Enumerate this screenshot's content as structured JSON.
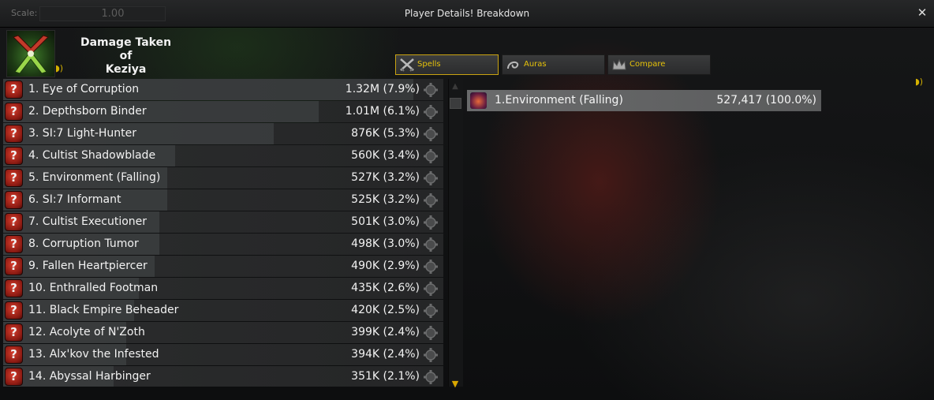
{
  "window": {
    "title": "Player Details! Breakdown",
    "scale_label": "Scale:",
    "scale_value": "1.00",
    "close_symbol": "✕"
  },
  "header": {
    "title_line1": "Damage Taken of",
    "title_line2": "Keziya"
  },
  "tabs": [
    {
      "label": "Spells",
      "icon": "crossed-swords-icon",
      "active": true
    },
    {
      "label": "Auras",
      "icon": "aura-swirl-icon",
      "active": false
    },
    {
      "label": "Compare",
      "icon": "crown-icon",
      "active": false
    }
  ],
  "list": {
    "rows": [
      {
        "name": "1. Eye of Corruption",
        "value": "1.32M (7.9%)",
        "bar_fraction": 1.0
      },
      {
        "name": "2. Depthsborn Binder",
        "value": "1.01M (6.1%)",
        "bar_fraction": 0.77
      },
      {
        "name": "3. SI:7 Light-Hunter",
        "value": "876K (5.3%)",
        "bar_fraction": 0.66
      },
      {
        "name": "4. Cultist Shadowblade",
        "value": "560K (3.4%)",
        "bar_fraction": 0.42
      },
      {
        "name": "5. Environment (Falling)",
        "value": "527K (3.2%)",
        "bar_fraction": 0.4
      },
      {
        "name": "6. SI:7 Informant",
        "value": "525K (3.2%)",
        "bar_fraction": 0.4
      },
      {
        "name": "7. Cultist Executioner",
        "value": "501K (3.0%)",
        "bar_fraction": 0.38
      },
      {
        "name": "8. Corruption Tumor",
        "value": "498K (3.0%)",
        "bar_fraction": 0.38
      },
      {
        "name": "9. Fallen Heartpiercer",
        "value": "490K (2.9%)",
        "bar_fraction": 0.37
      },
      {
        "name": "10. Enthralled Footman",
        "value": "435K (2.6%)",
        "bar_fraction": 0.33
      },
      {
        "name": "11. Black Empire Beheader",
        "value": "420K (2.5%)",
        "bar_fraction": 0.32
      },
      {
        "name": "12. Acolyte of N'Zoth",
        "value": "399K (2.4%)",
        "bar_fraction": 0.3
      },
      {
        "name": "13. Alx'kov the Infested",
        "value": "394K (2.4%)",
        "bar_fraction": 0.3
      },
      {
        "name": "14. Abyssal Harbinger",
        "value": "351K (2.1%)",
        "bar_fraction": 0.27
      }
    ]
  },
  "spells": [
    {
      "name": "1.Environment (Falling)",
      "value": "527,417 (100.0%)"
    }
  ],
  "colors": {
    "accent": "#e6c20a",
    "row_bg": "#2b2c2d",
    "spell_row_bg": "#6a6b6c",
    "question_icon": "#b02a1e"
  }
}
